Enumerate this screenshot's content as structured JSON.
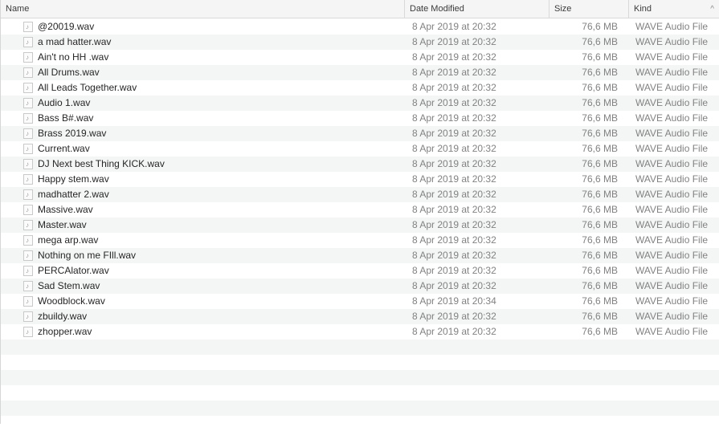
{
  "columns": {
    "name": "Name",
    "date": "Date Modified",
    "size": "Size",
    "kind": "Kind",
    "sort_indicator": "^"
  },
  "files": [
    {
      "name": "@20019.wav",
      "date": "8 Apr 2019 at 20:32",
      "size": "76,6 MB",
      "kind": "WAVE Audio File"
    },
    {
      "name": "a mad hatter.wav",
      "date": "8 Apr 2019 at 20:32",
      "size": "76,6 MB",
      "kind": "WAVE Audio File"
    },
    {
      "name": "Ain't no HH .wav",
      "date": "8 Apr 2019 at 20:32",
      "size": "76,6 MB",
      "kind": "WAVE Audio File"
    },
    {
      "name": "All Drums.wav",
      "date": "8 Apr 2019 at 20:32",
      "size": "76,6 MB",
      "kind": "WAVE Audio File"
    },
    {
      "name": "All Leads Together.wav",
      "date": "8 Apr 2019 at 20:32",
      "size": "76,6 MB",
      "kind": "WAVE Audio File"
    },
    {
      "name": "Audio 1.wav",
      "date": "8 Apr 2019 at 20:32",
      "size": "76,6 MB",
      "kind": "WAVE Audio File"
    },
    {
      "name": "Bass B#.wav",
      "date": "8 Apr 2019 at 20:32",
      "size": "76,6 MB",
      "kind": "WAVE Audio File"
    },
    {
      "name": "Brass 2019.wav",
      "date": "8 Apr 2019 at 20:32",
      "size": "76,6 MB",
      "kind": "WAVE Audio File"
    },
    {
      "name": "Current.wav",
      "date": "8 Apr 2019 at 20:32",
      "size": "76,6 MB",
      "kind": "WAVE Audio File"
    },
    {
      "name": "DJ Next best Thing KICK.wav",
      "date": "8 Apr 2019 at 20:32",
      "size": "76,6 MB",
      "kind": "WAVE Audio File"
    },
    {
      "name": "Happy stem.wav",
      "date": "8 Apr 2019 at 20:32",
      "size": "76,6 MB",
      "kind": "WAVE Audio File"
    },
    {
      "name": "madhatter 2.wav",
      "date": "8 Apr 2019 at 20:32",
      "size": "76,6 MB",
      "kind": "WAVE Audio File"
    },
    {
      "name": "Massive.wav",
      "date": "8 Apr 2019 at 20:32",
      "size": "76,6 MB",
      "kind": "WAVE Audio File"
    },
    {
      "name": "Master.wav",
      "date": "8 Apr 2019 at 20:32",
      "size": "76,6 MB",
      "kind": "WAVE Audio File"
    },
    {
      "name": "mega arp.wav",
      "date": "8 Apr 2019 at 20:32",
      "size": "76,6 MB",
      "kind": "WAVE Audio File"
    },
    {
      "name": "Nothing on me FIll.wav",
      "date": "8 Apr 2019 at 20:32",
      "size": "76,6 MB",
      "kind": "WAVE Audio File"
    },
    {
      "name": "PERCAlator.wav",
      "date": "8 Apr 2019 at 20:32",
      "size": "76,6 MB",
      "kind": "WAVE Audio File"
    },
    {
      "name": "Sad Stem.wav",
      "date": "8 Apr 2019 at 20:32",
      "size": "76,6 MB",
      "kind": "WAVE Audio File"
    },
    {
      "name": "Woodblock.wav",
      "date": "8 Apr 2019 at 20:34",
      "size": "76,6 MB",
      "kind": "WAVE Audio File"
    },
    {
      "name": "zbuildy.wav",
      "date": "8 Apr 2019 at 20:32",
      "size": "76,6 MB",
      "kind": "WAVE Audio File"
    },
    {
      "name": "zhopper.wav",
      "date": "8 Apr 2019 at 20:32",
      "size": "76,6 MB",
      "kind": "WAVE Audio File"
    }
  ],
  "icon": "audio-file-icon",
  "colors": {
    "header_bg": "#f5f5f5",
    "row_alt": "#f4f5f5",
    "secondary_text": "#828282"
  }
}
